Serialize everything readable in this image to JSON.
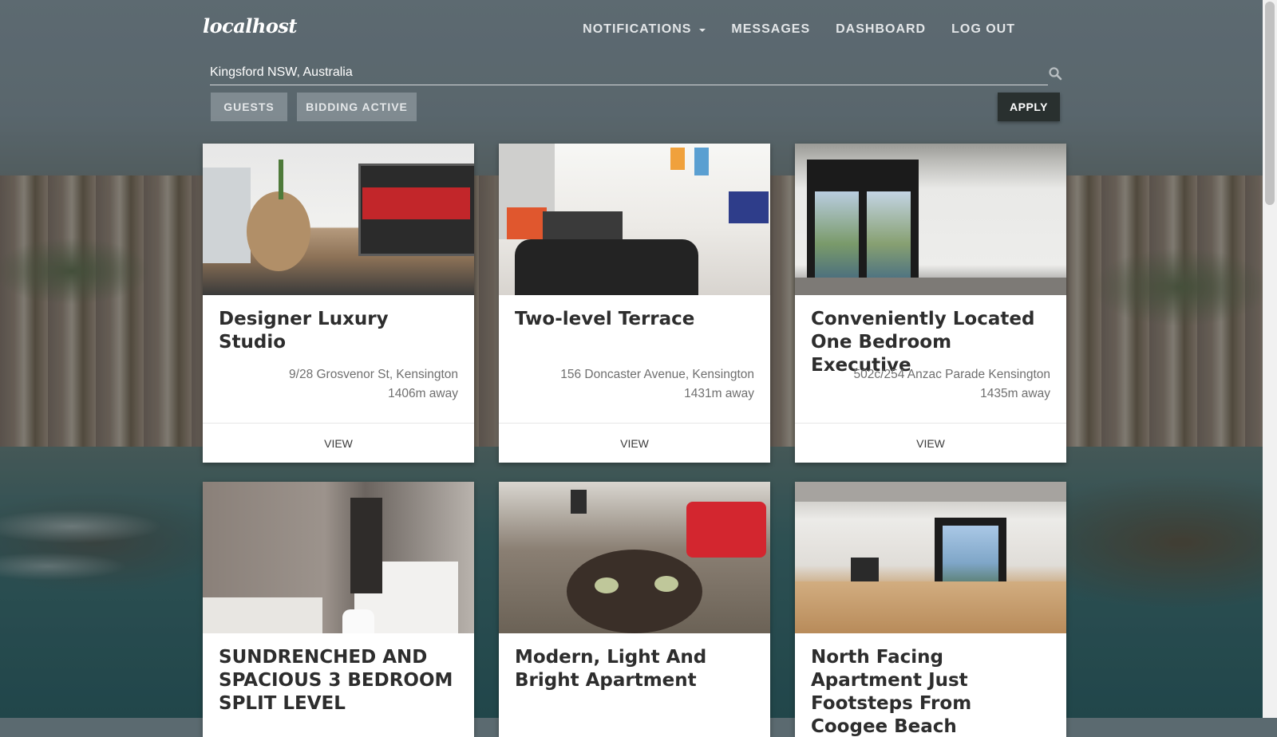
{
  "header": {
    "logo": "localhost",
    "nav": [
      {
        "label": "NOTIFICATIONS"
      },
      {
        "label": "MESSAGES"
      },
      {
        "label": "DASHBOARD"
      },
      {
        "label": "LOG OUT"
      }
    ]
  },
  "search": {
    "value": "Kingsford NSW, Australia",
    "placeholder": ""
  },
  "filters": {
    "guests_label": "GUESTS",
    "bidding_label": "BIDDING ACTIVE",
    "apply_label": "APPLY"
  },
  "listings": [
    {
      "title": "Designer Luxury Studio",
      "address": "9/28 Grosvenor St, Kensington",
      "distance": "1406m away",
      "action": "VIEW"
    },
    {
      "title": "Two-level Terrace",
      "address": "156 Doncaster Avenue, Kensington",
      "distance": "1431m away",
      "action": "VIEW"
    },
    {
      "title": "Conveniently Located One Bedroom Executive",
      "address": "502c/254 Anzac Parade Kensington",
      "distance": "1435m away",
      "action": "VIEW"
    },
    {
      "title": "SUNDRENCHED AND SPACIOUS 3 BEDROOM SPLIT LEVEL",
      "address": "",
      "distance": "",
      "action": ""
    },
    {
      "title": "Modern, Light And Bright Apartment",
      "address": "",
      "distance": "",
      "action": ""
    },
    {
      "title": "North Facing Apartment Just Footsteps From Coogee Beach",
      "address": "",
      "distance": "",
      "action": ""
    }
  ],
  "colors": {
    "apply_bg": "#29302f",
    "card_bg": "#ffffff",
    "chip_bg": "#a0aaaf"
  },
  "icons": {
    "search": "search-icon",
    "dropdown": "chevron-down-icon"
  }
}
